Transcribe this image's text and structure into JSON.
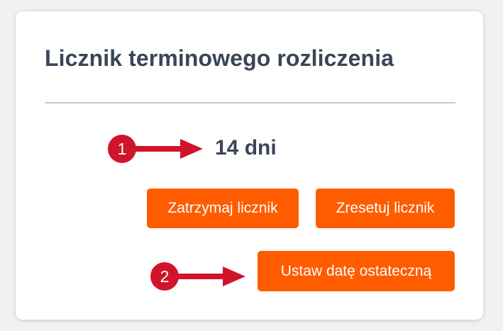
{
  "card": {
    "title": "Licznik terminowego rozliczenia",
    "counter_value": "14 dni"
  },
  "annotations": {
    "marker_1": "1",
    "marker_2": "2"
  },
  "buttons": {
    "stop_label": "Zatrzymaj licznik",
    "reset_label": "Zresetuj licznik",
    "set_deadline_label": "Ustaw datę ostateczną"
  },
  "colors": {
    "accent": "#ff5c00",
    "annotation": "#d0152a",
    "title_text": "#3a4557"
  }
}
